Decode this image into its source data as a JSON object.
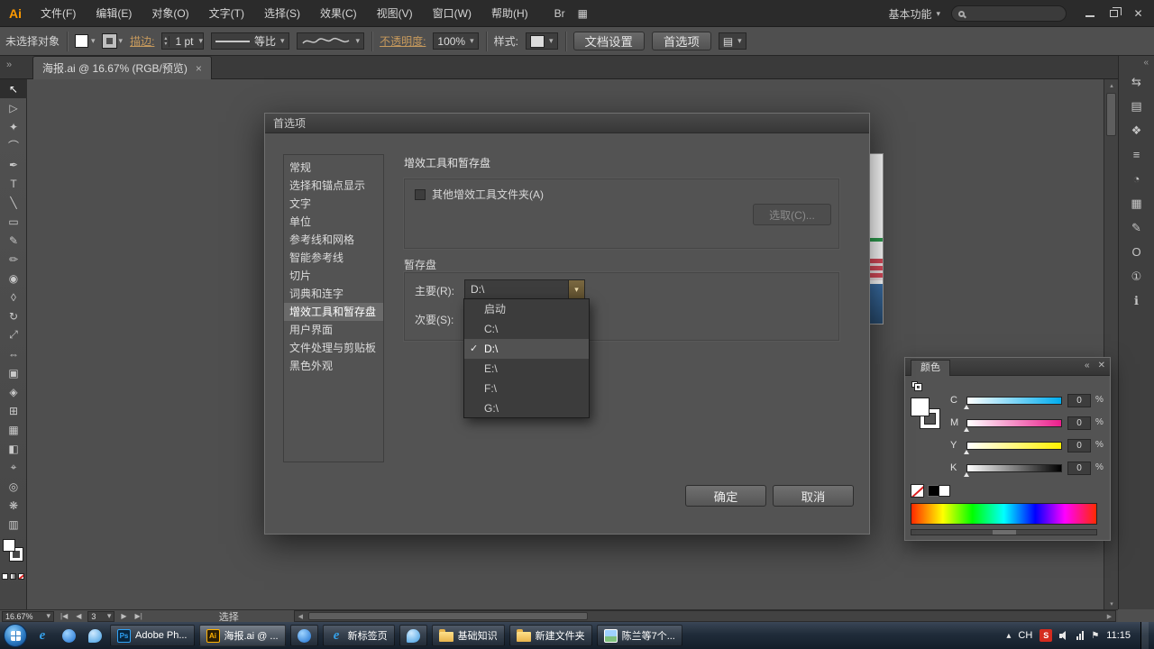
{
  "colors": {
    "accent_orange": "#ff9a00",
    "ui_background": "#4f4f4f",
    "dialog_background": "#535353",
    "selection_highlight": "#6a6a6a",
    "slider_cyan": "#00adef",
    "slider_magenta": "#ec1e8c",
    "slider_yellow": "#fff100",
    "taskbar_blue": "#1c2735"
  },
  "glyphs": {
    "down": "▾",
    "up": "▴",
    "left": "◀",
    "right": "▶",
    "check": "✓",
    "flag": "⚑"
  },
  "menu_bar": {
    "logo": "Ai",
    "items": [
      "文件(F)",
      "编辑(E)",
      "对象(O)",
      "文字(T)",
      "选择(S)",
      "效果(C)",
      "视图(V)",
      "窗口(W)",
      "帮助(H)"
    ],
    "bridge_label": "Br",
    "arrange_icon": "▦",
    "workspace_label": "基本功能",
    "search_value": "",
    "close_glyph": "✕"
  },
  "control_bar": {
    "selection_status": "未选择对象",
    "stroke_label": "描边:",
    "stroke_value": "1 pt",
    "profile_value": "等比",
    "opacity_label": "不透明度:",
    "opacity_value": "100%",
    "style_label": "样式:",
    "doc_setup_label": "文档设置",
    "preferences_label": "首选项",
    "panel_menu_icon": "▤"
  },
  "tab_bar": {
    "expand_glyph": "»",
    "active_tab": "海报.ai @ 16.67% (RGB/预览)",
    "close_glyph": "×"
  },
  "tools": [
    {
      "name": "selection-tool",
      "glyph": "↖"
    },
    {
      "name": "direct-selection-tool",
      "glyph": "▷"
    },
    {
      "name": "magic-wand-tool",
      "glyph": "✦"
    },
    {
      "name": "lasso-tool",
      "glyph": "⌒"
    },
    {
      "name": "pen-tool",
      "glyph": "✒"
    },
    {
      "name": "type-tool",
      "glyph": "T"
    },
    {
      "name": "line-segment-tool",
      "glyph": "╲"
    },
    {
      "name": "rectangle-tool",
      "glyph": "▭"
    },
    {
      "name": "paintbrush-tool",
      "glyph": "✎"
    },
    {
      "name": "pencil-tool",
      "glyph": "✏"
    },
    {
      "name": "blob-brush-tool",
      "glyph": "◉"
    },
    {
      "name": "eraser-tool",
      "glyph": "◊"
    },
    {
      "name": "rotate-tool",
      "glyph": "↻"
    },
    {
      "name": "scale-tool",
      "glyph": "⤢"
    },
    {
      "name": "width-tool",
      "glyph": "⇔"
    },
    {
      "name": "free-transform-tool",
      "glyph": "▣"
    },
    {
      "name": "shape-builder-tool",
      "glyph": "◈"
    },
    {
      "name": "perspective-grid-tool",
      "glyph": "⊞"
    },
    {
      "name": "mesh-tool",
      "glyph": "▦"
    },
    {
      "name": "gradient-tool",
      "glyph": "◧"
    },
    {
      "name": "eyedropper-tool",
      "glyph": "⌖"
    },
    {
      "name": "blend-tool",
      "glyph": "◎"
    },
    {
      "name": "symbol-sprayer-tool",
      "glyph": "❋"
    },
    {
      "name": "column-graph-tool",
      "glyph": "▥"
    }
  ],
  "dock": {
    "collapse_glyph": "«",
    "icons": [
      {
        "name": "kuler-panel-icon",
        "glyph": "⇆"
      },
      {
        "name": "layers-panel-icon",
        "glyph": "▤"
      },
      {
        "name": "graphic-styles-panel-icon",
        "glyph": "❖"
      },
      {
        "name": "stroke-panel-icon",
        "glyph": "≡"
      },
      {
        "name": "transparency-panel-icon",
        "glyph": "◔"
      },
      {
        "name": "symbols-panel-icon",
        "glyph": "▦"
      },
      {
        "name": "appearance-panel-icon",
        "glyph": "✎"
      },
      {
        "name": "attributes-panel-icon",
        "glyph": "O"
      },
      {
        "name": "variables-panel-icon",
        "glyph": "①"
      },
      {
        "name": "info-panel-icon",
        "glyph": "ℹ"
      }
    ]
  },
  "dialog": {
    "title": "首选项",
    "categories": [
      "常规",
      "选择和锚点显示",
      "文字",
      "单位",
      "参考线和网格",
      "智能参考线",
      "切片",
      "词典和连字",
      "增效工具和暂存盘",
      "用户界面",
      "文件处理与剪贴板",
      "黑色外观"
    ],
    "selected_category_index": 8,
    "heading": "增效工具和暂存盘",
    "other_plugins_label": "其他增效工具文件夹(A)",
    "choose_button": "选取(C)...",
    "scratch_group_title": "暂存盘",
    "primary_label": "主要(R):",
    "primary_value": "D:\\",
    "secondary_label": "次要(S):",
    "dropdown_options": [
      "启动",
      "C:\\",
      "D:\\",
      "E:\\",
      "F:\\",
      "G:\\"
    ],
    "dropdown_selected_index": 2,
    "ok_label": "确定",
    "cancel_label": "取消"
  },
  "color_panel": {
    "title": "颜色",
    "collapse_glyph": "«",
    "close_glyph": "✕",
    "channels": [
      {
        "label": "C",
        "value": "0"
      },
      {
        "label": "M",
        "value": "0"
      },
      {
        "label": "Y",
        "value": "0"
      },
      {
        "label": "K",
        "value": "0"
      }
    ],
    "unit": "%"
  },
  "status_bar": {
    "zoom": "16.67%",
    "first_glyph": "|◀",
    "prev_glyph": "◀",
    "artboard_number": "3",
    "next_glyph": "▶",
    "last_glyph": "▶|",
    "tool_hint": "选择"
  },
  "taskbar": {
    "ps_glyph": "Ps",
    "ai_glyph": "Ai",
    "ie_glyph": "e",
    "buttons": [
      {
        "label": "Adobe Ph..."
      },
      {
        "label": "海报.ai @ ..."
      },
      {
        "label": ""
      },
      {
        "label": "新标签页"
      },
      {
        "label": ""
      },
      {
        "label": "基础知识"
      },
      {
        "label": "新建文件夹"
      },
      {
        "label": "陈兰等7个..."
      }
    ],
    "tray": {
      "hidden_glyph": "▴",
      "input_label": "CH",
      "ime_label": "S",
      "time": "11:15"
    }
  }
}
